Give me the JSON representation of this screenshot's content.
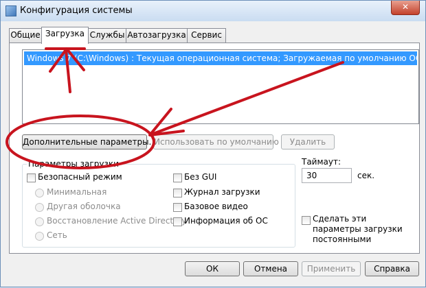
{
  "window": {
    "title": "Конфигурация системы",
    "close_glyph": "✕"
  },
  "tabs": [
    "Общие",
    "Загрузка",
    "Службы",
    "Автозагрузка",
    "Сервис"
  ],
  "active_tab": "Загрузка",
  "os_list": {
    "selected_item": "Windows 7 (C:\\Windows) : Текущая операционная система; Загружаемая по умолчанию ОС"
  },
  "buttons": {
    "advanced": "Дополнительные параметры...",
    "set_default": "Использовать по умолчанию",
    "delete": "Удалить",
    "ok": "ОК",
    "cancel": "Отмена",
    "apply": "Применить",
    "help": "Справка"
  },
  "boot_options": {
    "legend": "Параметры загрузки",
    "safe_mode": "Безопасный режим",
    "radios": [
      "Минимальная",
      "Другая оболочка",
      "Восстановление Active Directory",
      "Сеть"
    ],
    "checkboxes": [
      "Без GUI",
      "Журнал загрузки",
      "Базовое видео",
      "Информация  об ОС"
    ]
  },
  "timeout": {
    "label": "Таймаут:",
    "value": "30",
    "unit": "сек."
  },
  "make_permanent": "Сделать эти параметры загрузки постоянными",
  "annotation_color": "#c8141e"
}
